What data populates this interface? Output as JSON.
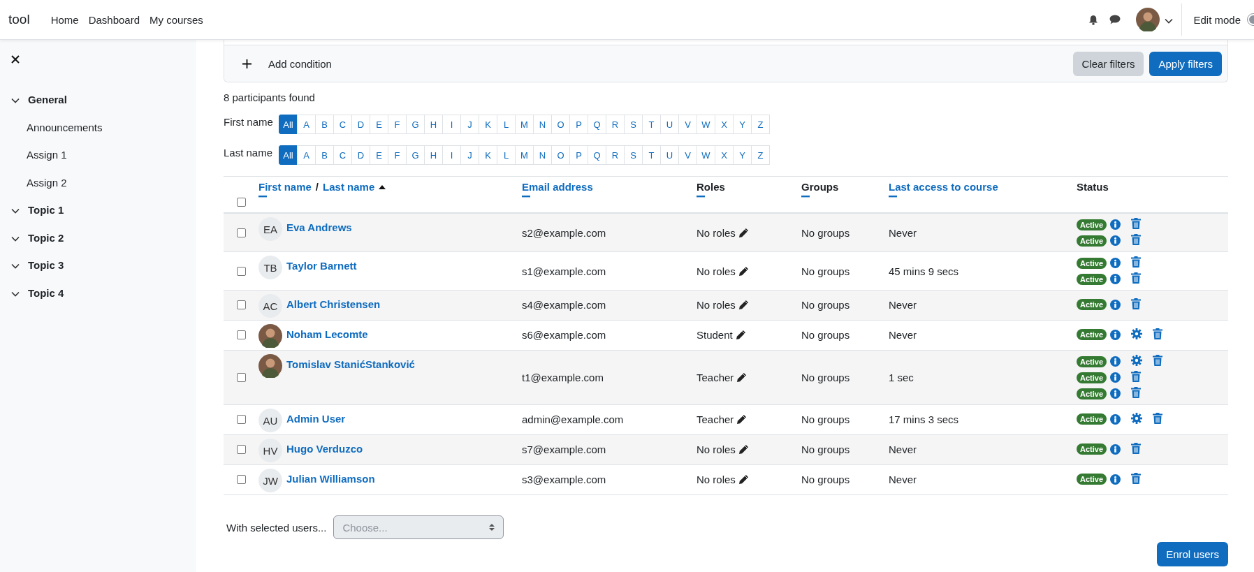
{
  "navbar": {
    "brand": "tool",
    "links": [
      "Home",
      "Dashboard",
      "My courses"
    ],
    "user_avatar": {
      "kind": "photo"
    },
    "edit_mode": {
      "label": "Edit mode",
      "on": false
    }
  },
  "sidebar": {
    "sections": [
      {
        "label": "General",
        "children": [
          "Announcements",
          "Assign 1",
          "Assign 2"
        ]
      },
      {
        "label": "Topic 1"
      },
      {
        "label": "Topic 2"
      },
      {
        "label": "Topic 3"
      },
      {
        "label": "Topic 4"
      }
    ]
  },
  "filters": {
    "add_condition": "Add condition",
    "buttons": [
      {
        "label": "Clear filters",
        "kind": "secondary"
      },
      {
        "label": "Apply filters",
        "kind": "primary"
      }
    ]
  },
  "participants_found": "8 participants found",
  "initials_bars": [
    {
      "label": "First name",
      "letters": [
        {
          "label": "All",
          "selected": true
        },
        {
          "label": "A",
          "selected": false
        },
        {
          "label": "B",
          "selected": false
        },
        {
          "label": "C",
          "selected": false
        },
        {
          "label": "D",
          "selected": false
        },
        {
          "label": "E",
          "selected": false
        },
        {
          "label": "F",
          "selected": false
        },
        {
          "label": "G",
          "selected": false
        },
        {
          "label": "H",
          "selected": false
        },
        {
          "label": "I",
          "selected": false
        },
        {
          "label": "J",
          "selected": false
        },
        {
          "label": "K",
          "selected": false
        },
        {
          "label": "L",
          "selected": false
        },
        {
          "label": "M",
          "selected": false
        },
        {
          "label": "N",
          "selected": false
        },
        {
          "label": "O",
          "selected": false
        },
        {
          "label": "P",
          "selected": false
        },
        {
          "label": "Q",
          "selected": false
        },
        {
          "label": "R",
          "selected": false
        },
        {
          "label": "S",
          "selected": false
        },
        {
          "label": "T",
          "selected": false
        },
        {
          "label": "U",
          "selected": false
        },
        {
          "label": "V",
          "selected": false
        },
        {
          "label": "W",
          "selected": false
        },
        {
          "label": "X",
          "selected": false
        },
        {
          "label": "Y",
          "selected": false
        },
        {
          "label": "Z",
          "selected": false
        }
      ]
    },
    {
      "label": "Last name",
      "letters": [
        {
          "label": "All",
          "selected": true
        },
        {
          "label": "A",
          "selected": false
        },
        {
          "label": "B",
          "selected": false
        },
        {
          "label": "C",
          "selected": false
        },
        {
          "label": "D",
          "selected": false
        },
        {
          "label": "E",
          "selected": false
        },
        {
          "label": "F",
          "selected": false
        },
        {
          "label": "G",
          "selected": false
        },
        {
          "label": "H",
          "selected": false
        },
        {
          "label": "I",
          "selected": false
        },
        {
          "label": "J",
          "selected": false
        },
        {
          "label": "K",
          "selected": false
        },
        {
          "label": "L",
          "selected": false
        },
        {
          "label": "M",
          "selected": false
        },
        {
          "label": "N",
          "selected": false
        },
        {
          "label": "O",
          "selected": false
        },
        {
          "label": "P",
          "selected": false
        },
        {
          "label": "Q",
          "selected": false
        },
        {
          "label": "R",
          "selected": false
        },
        {
          "label": "S",
          "selected": false
        },
        {
          "label": "T",
          "selected": false
        },
        {
          "label": "U",
          "selected": false
        },
        {
          "label": "V",
          "selected": false
        },
        {
          "label": "W",
          "selected": false
        },
        {
          "label": "X",
          "selected": false
        },
        {
          "label": "Y",
          "selected": false
        },
        {
          "label": "Z",
          "selected": false
        }
      ]
    }
  ],
  "table": {
    "select_all": {
      "checked": false
    },
    "name_header": {
      "first": "First name",
      "separator": "/",
      "last": "Last name"
    },
    "columns": [
      {
        "label": "Email address",
        "sortable": true
      },
      {
        "label": "Roles",
        "sortable": false
      },
      {
        "label": "Groups",
        "sortable": false
      },
      {
        "label": "Last access to course",
        "sortable": true
      },
      {
        "label": "Status",
        "sortable": false
      }
    ],
    "rows": [
      {
        "checked": false,
        "avatar": {
          "kind": "initials",
          "initials": "EA"
        },
        "name": "Eva Andrews",
        "email": "s2@example.com",
        "roles": "No roles",
        "groups": "No groups",
        "last_access": "Never",
        "enrolments": [
          {
            "status": "Active",
            "settings": false
          },
          {
            "status": "Active",
            "settings": false
          }
        ]
      },
      {
        "checked": false,
        "avatar": {
          "kind": "initials",
          "initials": "TB"
        },
        "name": "Taylor Barnett",
        "email": "s1@example.com",
        "roles": "No roles",
        "groups": "No groups",
        "last_access": "45 mins 9 secs",
        "enrolments": [
          {
            "status": "Active",
            "settings": false
          },
          {
            "status": "Active",
            "settings": false
          }
        ]
      },
      {
        "checked": false,
        "avatar": {
          "kind": "initials",
          "initials": "AC"
        },
        "name": "Albert Christensen",
        "email": "s4@example.com",
        "roles": "No roles",
        "groups": "No groups",
        "last_access": "Never",
        "enrolments": [
          {
            "status": "Active",
            "settings": false
          }
        ]
      },
      {
        "checked": false,
        "avatar": {
          "kind": "photo"
        },
        "name": "Noham Lecomte",
        "email": "s6@example.com",
        "roles": "Student",
        "groups": "No groups",
        "last_access": "Never",
        "enrolments": [
          {
            "status": "Active",
            "settings": true
          }
        ]
      },
      {
        "checked": false,
        "avatar": {
          "kind": "photo"
        },
        "name": "Tomislav StanićStanković",
        "email": "t1@example.com",
        "roles": "Teacher",
        "groups": "No groups",
        "last_access": "1 sec",
        "enrolments": [
          {
            "status": "Active",
            "settings": true
          },
          {
            "status": "Active",
            "settings": false
          },
          {
            "status": "Active",
            "settings": false
          }
        ]
      },
      {
        "checked": false,
        "avatar": {
          "kind": "initials",
          "initials": "AU"
        },
        "name": "Admin User",
        "email": "admin@example.com",
        "roles": "Teacher",
        "groups": "No groups",
        "last_access": "17 mins 3 secs",
        "enrolments": [
          {
            "status": "Active",
            "settings": true
          }
        ]
      },
      {
        "checked": false,
        "avatar": {
          "kind": "initials",
          "initials": "HV"
        },
        "name": "Hugo Verduzco",
        "email": "s7@example.com",
        "roles": "No roles",
        "groups": "No groups",
        "last_access": "Never",
        "enrolments": [
          {
            "status": "Active",
            "settings": false
          }
        ]
      },
      {
        "checked": false,
        "avatar": {
          "kind": "initials",
          "initials": "JW"
        },
        "name": "Julian Williamson",
        "email": "s3@example.com",
        "roles": "No roles",
        "groups": "No groups",
        "last_access": "Never",
        "enrolments": [
          {
            "status": "Active",
            "settings": false
          }
        ]
      }
    ]
  },
  "bulk_action": {
    "label": "With selected users...",
    "placeholder": "Choose..."
  },
  "enrol_button": "Enrol users"
}
